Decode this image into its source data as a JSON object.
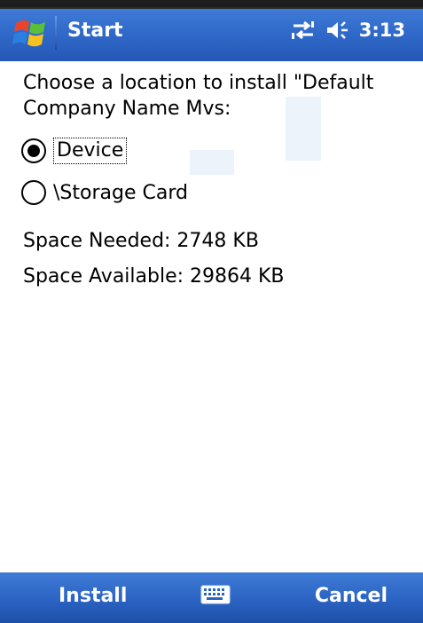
{
  "titlebar": {
    "title": "Start",
    "time": "3:13",
    "icons": [
      "windows-start-logo",
      "connectivity-icon",
      "volume-icon"
    ]
  },
  "content": {
    "prompt": "Choose a location to install \"Default\nCompany Name Mvs:",
    "options": [
      {
        "label": "Device",
        "selected": true
      },
      {
        "label": "\\Storage Card",
        "selected": false
      }
    ],
    "space_needed": "Space Needed:  2748 KB",
    "space_available": "Space Available: 29864 KB"
  },
  "menubar": {
    "left_softkey": "Install",
    "right_softkey": "Cancel",
    "center_icon": "keyboard-icon"
  },
  "colors": {
    "titlebar": "#2f68c8",
    "menubar": "#2b63c2",
    "text": "#000000",
    "background": "#ffffff"
  }
}
